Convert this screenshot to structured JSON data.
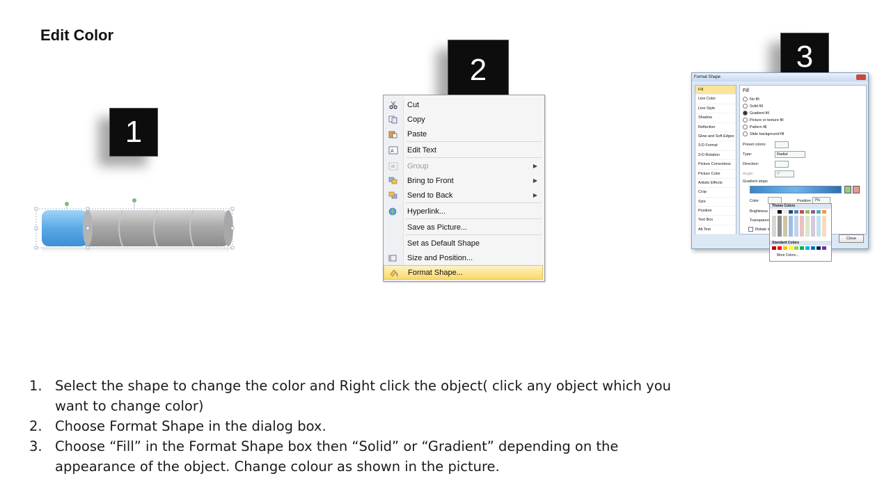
{
  "slide": {
    "title": "Edit Color",
    "steps": [
      {
        "number": "1"
      },
      {
        "number": "2"
      },
      {
        "number": "3"
      }
    ]
  },
  "shape": {
    "segments": 5,
    "highlight_color": "#64b0e8",
    "base_color": "#b4b4b4"
  },
  "context_menu": {
    "items": [
      {
        "label": "Cut",
        "icon": "scissors-icon",
        "disabled": false,
        "submenu": false
      },
      {
        "label": "Copy",
        "icon": "copy-icon",
        "disabled": false,
        "submenu": false
      },
      {
        "label": "Paste",
        "icon": "paste-icon",
        "disabled": false,
        "submenu": false
      },
      {
        "label": "Edit Text",
        "icon": "edit-text-icon",
        "disabled": false,
        "submenu": false
      },
      {
        "label": "Group",
        "icon": "group-icon",
        "disabled": true,
        "submenu": true
      },
      {
        "label": "Bring to Front",
        "icon": "bring-front-icon",
        "disabled": false,
        "submenu": true
      },
      {
        "label": "Send to Back",
        "icon": "send-back-icon",
        "disabled": false,
        "submenu": true
      },
      {
        "label": "Hyperlink...",
        "icon": "hyperlink-icon",
        "disabled": false,
        "submenu": false
      },
      {
        "label": "Save as Picture...",
        "icon": "",
        "disabled": false,
        "submenu": false
      },
      {
        "label": "Set as Default Shape",
        "icon": "",
        "disabled": false,
        "submenu": false
      },
      {
        "label": "Size and Position...",
        "icon": "size-position-icon",
        "disabled": false,
        "submenu": false
      },
      {
        "label": "Format Shape...",
        "icon": "format-shape-icon",
        "disabled": false,
        "submenu": false,
        "selected": true
      }
    ]
  },
  "format_dialog": {
    "title": "Format Shape",
    "categories": [
      "Fill",
      "Line Color",
      "Line Style",
      "Shadow",
      "Reflection",
      "Glow and Soft Edges",
      "3-D Format",
      "3-D Rotation",
      "Picture Corrections",
      "Picture Color",
      "Artistic Effects",
      "Crop",
      "Size",
      "Position",
      "Text Box",
      "Alt Text"
    ],
    "section": "Fill",
    "options": [
      "No fill",
      "Solid fill",
      "Gradient fill",
      "Picture or texture fill",
      "Pattern fill",
      "Slide background fill"
    ],
    "selected_option": "Gradient fill",
    "preset_label": "Preset colors:",
    "type_label": "Type:",
    "type_value": "Radial",
    "direction_label": "Direction:",
    "angle_label": "Angle:",
    "angle_value": "0°",
    "stops_label": "Gradient stops",
    "color_label": "Color",
    "position_label": "Position:",
    "position_value": "7%",
    "brightness_label": "Brightness",
    "transparency_label": "Transparen",
    "rotate_label": "Rotate w",
    "close_label": "Close",
    "theme_colors_label": "Theme Colors",
    "standard_colors_label": "Standard Colors",
    "more_colors_label": "More Colors..."
  },
  "instructions": [
    {
      "n": "1.",
      "text": "Select the shape to change the color and Right click the object( click any object which you want to change color)"
    },
    {
      "n": "2.",
      "text": "Choose Format Shape in the dialog box."
    },
    {
      "n": "3.",
      "text": "Choose “Fill” in the Format Shape box then “Solid” or “Gradient” depending on the appearance of the object. Change colour as shown in the picture."
    }
  ]
}
